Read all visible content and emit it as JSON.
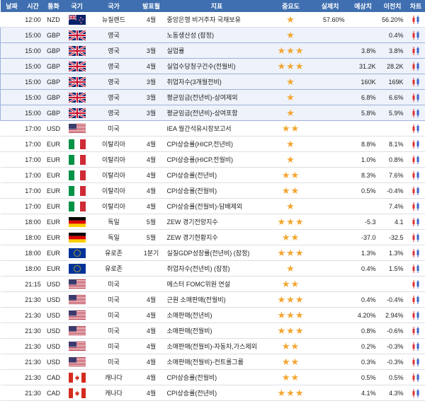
{
  "columns": [
    "날짜",
    "시간",
    "통화",
    "국기",
    "국가",
    "발표월",
    "지표",
    "중요도",
    "실제치",
    "예상치",
    "이전치",
    "차트"
  ],
  "rows": [
    {
      "time": "12:00",
      "currency": "NZD",
      "flag": "nz",
      "country": "뉴질랜드",
      "month": "4월",
      "indicator": "중앙은행 비거주자 국채보유",
      "importance": 1,
      "actual": "57.60%",
      "forecast": "",
      "previous": "56.20%",
      "hl": false
    },
    {
      "time": "15:00",
      "currency": "GBP",
      "flag": "gb",
      "country": "영국",
      "month": "",
      "indicator": "노동생산성 (잠정)",
      "importance": 1,
      "actual": "",
      "forecast": "",
      "previous": "0.4%",
      "hl": true
    },
    {
      "time": "15:00",
      "currency": "GBP",
      "flag": "gb",
      "country": "영국",
      "month": "3월",
      "indicator": "실업률",
      "importance": 3,
      "actual": "",
      "forecast": "3.8%",
      "previous": "3.8%",
      "hl": true
    },
    {
      "time": "15:00",
      "currency": "GBP",
      "flag": "gb",
      "country": "영국",
      "month": "4월",
      "indicator": "실업수당청구건수(전월비)",
      "importance": 3,
      "actual": "",
      "forecast": "31.2K",
      "previous": "28.2K",
      "hl": true
    },
    {
      "time": "15:00",
      "currency": "GBP",
      "flag": "gb",
      "country": "영국",
      "month": "3월",
      "indicator": "취업자수(3개월전비)",
      "importance": 1,
      "actual": "",
      "forecast": "160K",
      "previous": "169K",
      "hl": true
    },
    {
      "time": "15:00",
      "currency": "GBP",
      "flag": "gb",
      "country": "영국",
      "month": "3월",
      "indicator": "평균임금(전년비)-상여제외",
      "importance": 1,
      "actual": "",
      "forecast": "6.8%",
      "previous": "6.6%",
      "hl": true
    },
    {
      "time": "15:00",
      "currency": "GBP",
      "flag": "gb",
      "country": "영국",
      "month": "3월",
      "indicator": "평균임금(전년비)-상여포함",
      "importance": 1,
      "actual": "",
      "forecast": "5.8%",
      "previous": "5.9%",
      "hl": true
    },
    {
      "time": "17:00",
      "currency": "USD",
      "flag": "us",
      "country": "미국",
      "month": "",
      "indicator": "IEA 월간석유시장보고서",
      "importance": 2,
      "actual": "",
      "forecast": "",
      "previous": "",
      "hl": false
    },
    {
      "time": "17:00",
      "currency": "EUR",
      "flag": "it",
      "country": "이탈리아",
      "month": "4월",
      "indicator": "CPI상승률(HICP,전년비)",
      "importance": 1,
      "actual": "",
      "forecast": "8.8%",
      "previous": "8.1%",
      "hl": false
    },
    {
      "time": "17:00",
      "currency": "EUR",
      "flag": "it",
      "country": "이탈리아",
      "month": "4월",
      "indicator": "CPI상승률(HICP,전월비)",
      "importance": 1,
      "actual": "",
      "forecast": "1.0%",
      "previous": "0.8%",
      "hl": false
    },
    {
      "time": "17:00",
      "currency": "EUR",
      "flag": "it",
      "country": "이탈리아",
      "month": "4월",
      "indicator": "CPI상승률(전년비)",
      "importance": 2,
      "actual": "",
      "forecast": "8.3%",
      "previous": "7.6%",
      "hl": false
    },
    {
      "time": "17:00",
      "currency": "EUR",
      "flag": "it",
      "country": "이탈리아",
      "month": "4월",
      "indicator": "CPI상승률(전월비)",
      "importance": 2,
      "actual": "",
      "forecast": "0.5%",
      "previous": "-0.4%",
      "hl": false
    },
    {
      "time": "17:00",
      "currency": "EUR",
      "flag": "it",
      "country": "이탈리아",
      "month": "4월",
      "indicator": "CPI상승률(전월비)-담배제외",
      "importance": 1,
      "actual": "",
      "forecast": "",
      "previous": "7.4%",
      "hl": false
    },
    {
      "time": "18:00",
      "currency": "EUR",
      "flag": "de",
      "country": "독일",
      "month": "5월",
      "indicator": "ZEW 경기전망지수",
      "importance": 3,
      "actual": "",
      "forecast": "-5.3",
      "previous": "4.1",
      "hl": false
    },
    {
      "time": "18:00",
      "currency": "EUR",
      "flag": "de",
      "country": "독일",
      "month": "5월",
      "indicator": "ZEW 경기현황지수",
      "importance": 2,
      "actual": "",
      "forecast": "-37.0",
      "previous": "-32.5",
      "hl": false
    },
    {
      "time": "18:00",
      "currency": "EUR",
      "flag": "eu",
      "country": "유로존",
      "month": "1분기",
      "indicator": "실질GDP성장률(전년비) (잠정)",
      "importance": 3,
      "actual": "",
      "forecast": "1.3%",
      "previous": "1.3%",
      "hl": false
    },
    {
      "time": "18:00",
      "currency": "EUR",
      "flag": "eu",
      "country": "유로존",
      "month": "",
      "indicator": "취업자수(전년비) (잠정)",
      "importance": 1,
      "actual": "",
      "forecast": "0.4%",
      "previous": "1.5%",
      "hl": false
    },
    {
      "time": "21:15",
      "currency": "USD",
      "flag": "us",
      "country": "미국",
      "month": "",
      "indicator": "메스터 FOMC위원 연설",
      "importance": 2,
      "actual": "",
      "forecast": "",
      "previous": "",
      "hl": false
    },
    {
      "time": "21:30",
      "currency": "USD",
      "flag": "us",
      "country": "미국",
      "month": "4월",
      "indicator": "근원 소매판매(전월비)",
      "importance": 3,
      "actual": "",
      "forecast": "0.4%",
      "previous": "-0.4%",
      "hl": false
    },
    {
      "time": "21:30",
      "currency": "USD",
      "flag": "us",
      "country": "미국",
      "month": "4월",
      "indicator": "소매판매(전년비)",
      "importance": 3,
      "actual": "",
      "forecast": "4.20%",
      "previous": "2.94%",
      "hl": false
    },
    {
      "time": "21:30",
      "currency": "USD",
      "flag": "us",
      "country": "미국",
      "month": "4월",
      "indicator": "소매판매(전월비)",
      "importance": 3,
      "actual": "",
      "forecast": "0.8%",
      "previous": "-0.6%",
      "hl": false
    },
    {
      "time": "21:30",
      "currency": "USD",
      "flag": "us",
      "country": "미국",
      "month": "4월",
      "indicator": "소매판매(전월비)-자동차,가스제외",
      "importance": 2,
      "actual": "",
      "forecast": "0.2%",
      "previous": "-0.3%",
      "hl": false
    },
    {
      "time": "21:30",
      "currency": "USD",
      "flag": "us",
      "country": "미국",
      "month": "4월",
      "indicator": "소매판매(전월비)-컨트롤그룹",
      "importance": 2,
      "actual": "",
      "forecast": "0.3%",
      "previous": "-0.3%",
      "hl": false
    },
    {
      "time": "21:30",
      "currency": "CAD",
      "flag": "ca",
      "country": "캐나다",
      "month": "4월",
      "indicator": "CPI상승률(전월비)",
      "importance": 2,
      "actual": "",
      "forecast": "0.5%",
      "previous": "0.5%",
      "hl": false
    },
    {
      "time": "21:30",
      "currency": "CAD",
      "flag": "ca",
      "country": "캐나다",
      "month": "4월",
      "indicator": "CPI상승률(전년비)",
      "importance": 3,
      "actual": "",
      "forecast": "4.1%",
      "previous": "4.3%",
      "hl": false
    }
  ],
  "icons": {
    "star": "star-icon",
    "chart": "chart-icon"
  },
  "colors": {
    "header": "#3f6fb0",
    "star": "#f3a530",
    "highlight": "#eef2fa"
  }
}
